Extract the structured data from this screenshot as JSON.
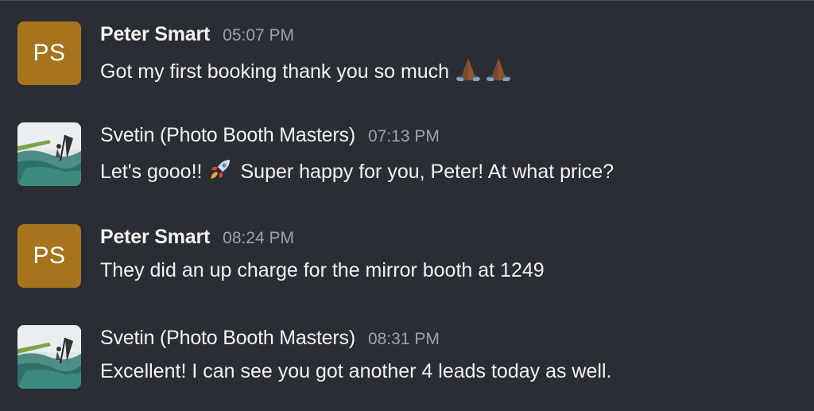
{
  "messages": [
    {
      "avatar": {
        "type": "initials",
        "initials": "PS",
        "color": "#a6741f"
      },
      "sender": "Peter Smart",
      "time": "05:07 PM",
      "text": "Got my first booking thank you so much",
      "trailing_icons": [
        "folded-hands-icon",
        "folded-hands-icon"
      ]
    },
    {
      "avatar": {
        "type": "photo",
        "icon": "windsurfer-photo-icon"
      },
      "sender": "Svetin (Photo Booth Masters)",
      "time": "07:13 PM",
      "text_before": "Let's gooo!!",
      "inline_icon": "rocket-icon",
      "text_after": "Super happy for you, Peter! At what price?"
    },
    {
      "avatar": {
        "type": "initials",
        "initials": "PS",
        "color": "#a6741f"
      },
      "sender": "Peter Smart",
      "time": "08:24 PM",
      "text": "They did an up charge for the mirror booth at 1249"
    },
    {
      "avatar": {
        "type": "photo",
        "icon": "windsurfer-photo-icon"
      },
      "sender": "Svetin (Photo Booth Masters)",
      "time": "08:31 PM",
      "text": "Excellent! I can see you got another 4 leads today as well."
    }
  ],
  "colors": {
    "background": "#2b2d34",
    "text": "#f2f2f3",
    "timestamp": "#a0a2a8",
    "avatar_initials_bg": "#a6741f"
  }
}
